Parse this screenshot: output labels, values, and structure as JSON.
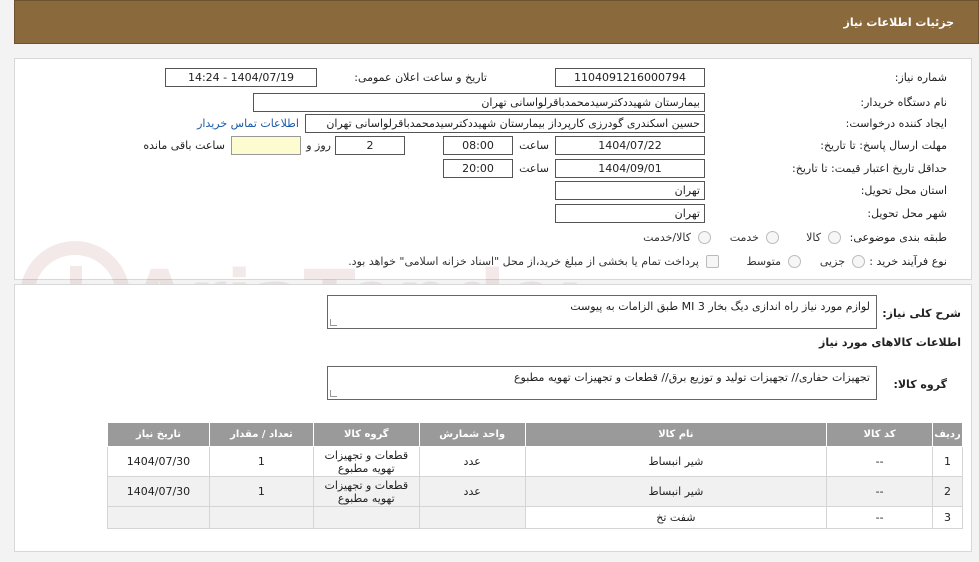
{
  "header": {
    "title": "جزئیات اطلاعات نیاز"
  },
  "form": {
    "need_number": {
      "label": "شماره نیاز:",
      "value": "1104091216000794"
    },
    "announce_date": {
      "label": "تاریخ و ساعت اعلان عمومی:",
      "value": "1404/07/19 - 14:24"
    },
    "buyer_org": {
      "label": "نام دستگاه خریدار:",
      "value": "بیمارستان شهیددکترسیدمحمدباقرلواسانی تهران"
    },
    "requester": {
      "label": "ایجاد کننده درخواست:",
      "value": "حسین اسکندری گودرزی کارپرداز بیمارستان شهیددکترسیدمحمدباقرلواسانی تهران",
      "contact_link": "اطلاعات تماس خریدار"
    },
    "deadline": {
      "label": "مهلت ارسال پاسخ: تا تاریخ:",
      "date": "1404/07/22",
      "time_label": "ساعت",
      "time": "08:00",
      "days": "2",
      "days_label": "روز و",
      "remaining_label": "ساعت باقی مانده",
      "remaining": ""
    },
    "validity": {
      "label": "حداقل تاریخ اعتبار قیمت: تا تاریخ:",
      "date": "1404/09/01",
      "time_label": "ساعت",
      "time": "20:00"
    },
    "province": {
      "label": "استان محل تحویل:",
      "value": "تهران"
    },
    "city": {
      "label": "شهر محل تحویل:",
      "value": "تهران"
    },
    "category": {
      "label": "طبقه بندی موضوعی:",
      "options": [
        "کالا",
        "خدمت",
        "کالا/خدمت"
      ]
    },
    "process": {
      "label": "نوع فرآیند خرید :",
      "options": [
        "جزیی",
        "متوسط"
      ],
      "payment_note": "پرداخت تمام یا بخشی از مبلغ خرید،از محل \"اسناد خزانه اسلامی\" خواهد بود."
    }
  },
  "goods": {
    "description_label": "شرح کلی نیاز:",
    "description": "لوازم مورد نیاز راه اندازی دیگ بخار MI 3 طبق الزامات به پیوست",
    "section_title": "اطلاعات کالاهای مورد نیاز",
    "group_label": "گروه کالا:",
    "group_value": "تجهیزات حفاری// تجهیزات تولید و توزیع برق//  قطعات و تجهیزات تهویه مطبوع",
    "table": {
      "headers": [
        "ردیف",
        "کد کالا",
        "نام کالا",
        "واحد شمارش",
        "گروه کالا",
        "تعداد / مقدار",
        "تاریخ نیاز"
      ],
      "rows": [
        [
          "1",
          "--",
          "شیر انبساط",
          "عدد",
          "قطعات و تجهیزات تهویه مطبوع",
          "1",
          "1404/07/30"
        ],
        [
          "2",
          "--",
          "شیر انبساط",
          "عدد",
          "قطعات و تجهیزات تهویه مطبوع",
          "1",
          "1404/07/30"
        ],
        [
          "3",
          "--",
          "شفت تخ",
          "",
          "",
          "",
          ""
        ]
      ]
    }
  },
  "watermark": {
    "text": "AriaTender.neT"
  }
}
